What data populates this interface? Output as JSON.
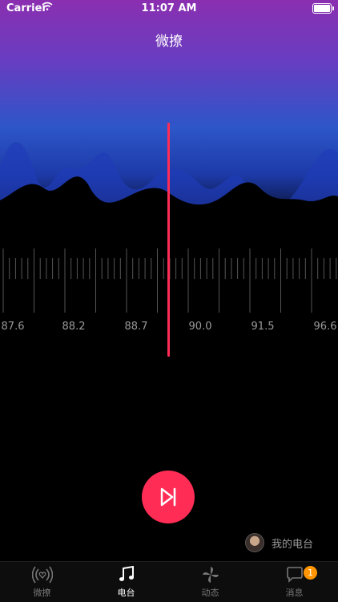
{
  "status_bar": {
    "carrier": "Carrier",
    "time": "11:07 AM"
  },
  "header": {
    "title": "微撩"
  },
  "dial": {
    "frequencies": [
      "87.6",
      "88.2",
      "88.7",
      "90.0",
      "91.5",
      "96.6"
    ]
  },
  "player": {
    "play_next_icon": "play-next-icon"
  },
  "my_station": {
    "label": "我的电台"
  },
  "tabs": [
    {
      "label": "微撩",
      "icon": "radio-signal-icon"
    },
    {
      "label": "电台",
      "icon": "music-note-icon"
    },
    {
      "label": "动态",
      "icon": "pinwheel-icon"
    },
    {
      "label": "消息",
      "icon": "chat-bubble-icon",
      "badge": "1"
    }
  ],
  "colors": {
    "accent": "#ff2d55",
    "badge": "#ff9500"
  }
}
